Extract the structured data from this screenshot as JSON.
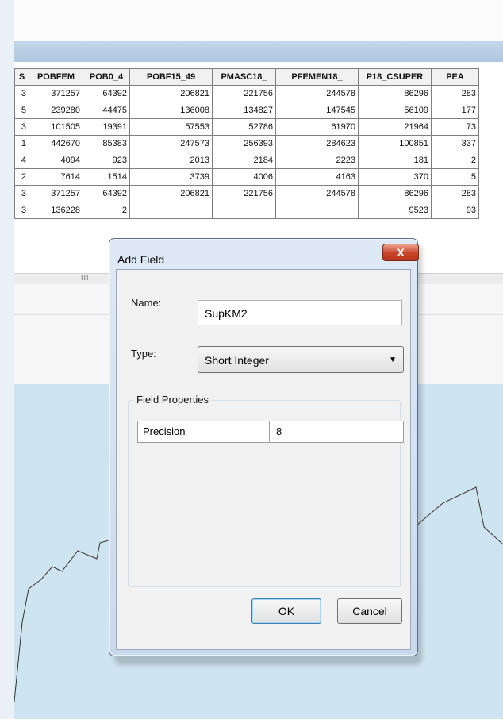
{
  "attribute_table": {
    "columns": [
      "S",
      "POBFEM",
      "POB0_4",
      "POBF15_49",
      "PMASC18_",
      "PFEMEN18_",
      "P18_CSUPER",
      "PEA"
    ],
    "rows": [
      [
        "3",
        "371257",
        "64392",
        "206821",
        "221756",
        "244578",
        "86296",
        "283"
      ],
      [
        "5",
        "239280",
        "44475",
        "136008",
        "134827",
        "147545",
        "56109",
        "177"
      ],
      [
        "3",
        "101505",
        "19391",
        "57553",
        "52786",
        "61970",
        "21964",
        "73"
      ],
      [
        "1",
        "442670",
        "85383",
        "247573",
        "256393",
        "284623",
        "100851",
        "337"
      ],
      [
        "4",
        "4094",
        "923",
        "2013",
        "2184",
        "2223",
        "181",
        "2"
      ],
      [
        "2",
        "7614",
        "1514",
        "3739",
        "4006",
        "4163",
        "370",
        "5"
      ],
      [
        "3",
        "371257",
        "64392",
        "206821",
        "221756",
        "244578",
        "86296",
        "283"
      ],
      [
        "3",
        "136228",
        "2",
        "",
        "",
        "",
        "9523",
        "93"
      ]
    ],
    "scroll_grip": "III"
  },
  "dialog": {
    "title": "Add Field",
    "close_label": "X",
    "name_label": "Name:",
    "name_value": "SupKM2",
    "type_label": "Type:",
    "type_value": "Short Integer",
    "field_properties_label": "Field Properties",
    "precision_label": "Precision",
    "precision_value": "8",
    "ok_label": "OK",
    "cancel_label": "Cancel"
  },
  "colors": {
    "map_fill": "#cfe4f1",
    "title_bar": "#b4cbe3",
    "close_button": "#c8452a"
  }
}
